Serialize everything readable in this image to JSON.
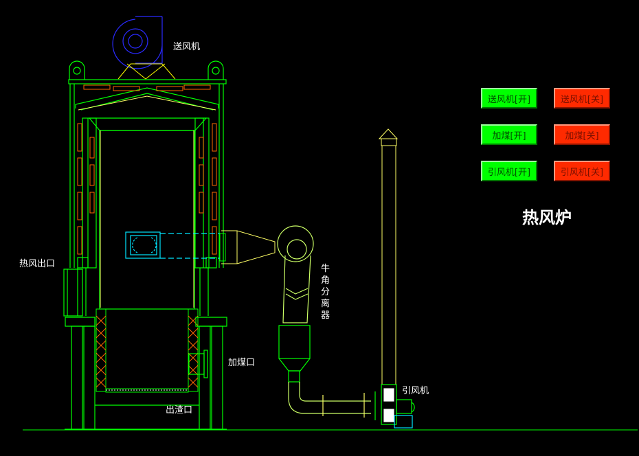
{
  "title": "热风炉",
  "labels": {
    "blower": "送风机",
    "hot_air_outlet": "热风出口",
    "coal_inlet": "加煤口",
    "slag_outlet": "出渣口",
    "separator": "牛角分离器",
    "induced_fan": "引风机"
  },
  "controls": [
    {
      "on_label": "送风机[开]",
      "off_label": "送风机[关]"
    },
    {
      "on_label": "加煤[开]",
      "off_label": "加煤[关]"
    },
    {
      "on_label": "引风机[开]",
      "off_label": "引风机[关]"
    }
  ],
  "colors": {
    "on": "#00ff00",
    "off": "#ff2a00",
    "line_green": "#00ff00",
    "line_yellow": "#ffff66",
    "line_blue": "#2222ff",
    "line_cyan": "#00e5ff",
    "line_orange": "#ff6a00"
  }
}
